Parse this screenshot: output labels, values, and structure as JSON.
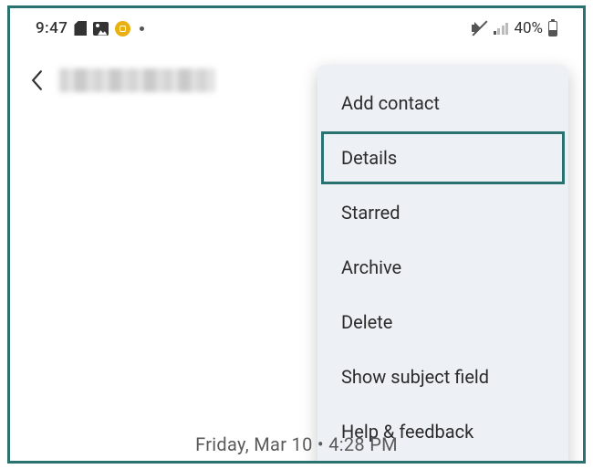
{
  "status_bar": {
    "time": "9:47",
    "battery_percent": "40%"
  },
  "menu": {
    "items": [
      {
        "label": "Add contact",
        "highlighted": false
      },
      {
        "label": "Details",
        "highlighted": true
      },
      {
        "label": "Starred",
        "highlighted": false
      },
      {
        "label": "Archive",
        "highlighted": false
      },
      {
        "label": "Delete",
        "highlighted": false
      },
      {
        "label": "Show subject field",
        "highlighted": false
      },
      {
        "label": "Help & feedback",
        "highlighted": false
      }
    ]
  },
  "timestamp": "Friday, Mar 10 • 4:28 PM"
}
